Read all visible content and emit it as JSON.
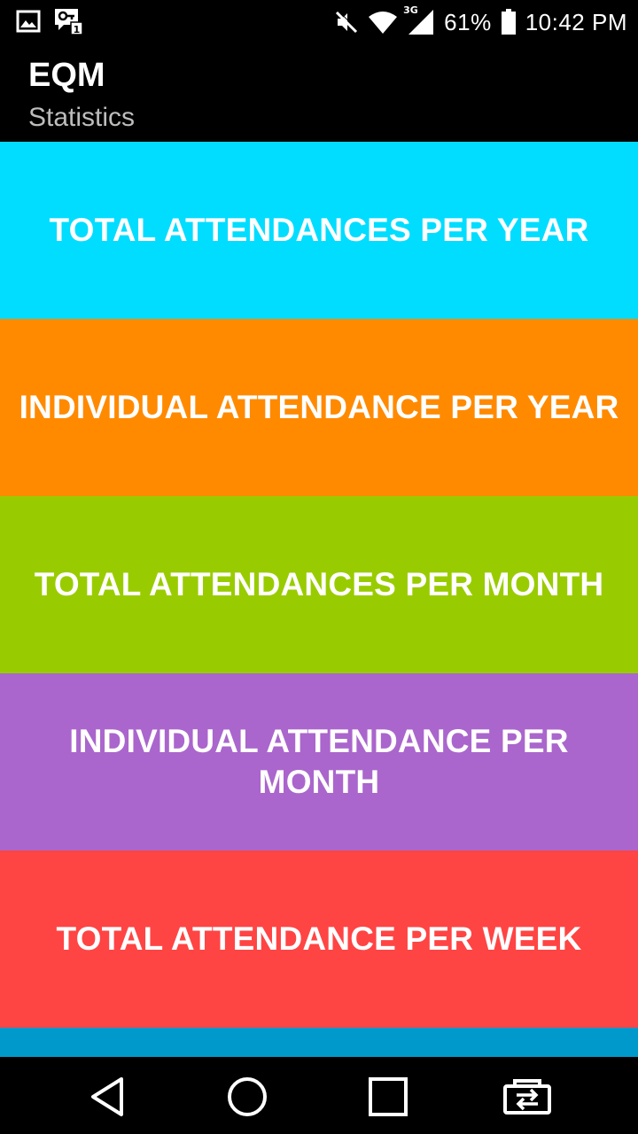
{
  "status_bar": {
    "battery_percent": "61%",
    "time": "10:42 PM",
    "network_type": "3G",
    "icons": [
      "gallery-icon",
      "vpn-key-icon",
      "mute-icon",
      "wifi-icon",
      "signal-icon",
      "battery-icon"
    ]
  },
  "app_bar": {
    "title": "EQM",
    "subtitle": "Statistics"
  },
  "tiles": [
    {
      "label": "TOTAL ATTENDANCES PER YEAR",
      "color": "#00DDFF"
    },
    {
      "label": "INDIVIDUAL ATTENDANCE PER YEAR",
      "color": "#FF8A00"
    },
    {
      "label": "TOTAL ATTENDANCES PER MONTH",
      "color": "#99CC00"
    },
    {
      "label": "INDIVIDUAL ATTENDANCE PER MONTH",
      "color": "#AA66CC"
    },
    {
      "label": "TOTAL ATTENDANCE PER WEEK",
      "color": "#FF4444"
    },
    {
      "label": "",
      "color": "#0099CC"
    }
  ],
  "nav_bar": {
    "icons": [
      "back-icon",
      "home-icon",
      "recents-icon",
      "switch-app-icon"
    ]
  }
}
